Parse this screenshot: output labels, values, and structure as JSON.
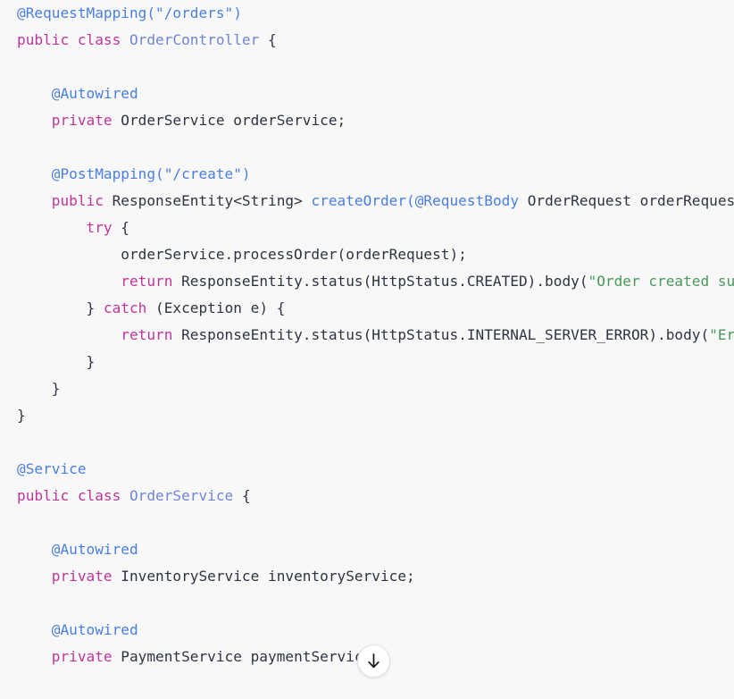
{
  "editor": {
    "background_color": "#f8f8f8",
    "font_size_px": 16,
    "line_height_px": 30,
    "language": "java",
    "syntax_colors": {
      "annotation": "#4a7fe0",
      "keyword": "#c0359b",
      "type_name": "#6f86d6",
      "function_name": "#4a7fe0",
      "string": "#49995c",
      "plain": "#2e3440"
    },
    "lines": [
      {
        "indent": 0,
        "tokens": [
          {
            "t": "@RequestMapping(\"/orders\")",
            "c": "ann"
          }
        ]
      },
      {
        "indent": 0,
        "tokens": [
          {
            "t": "public class ",
            "c": "kw"
          },
          {
            "t": "OrderController",
            "c": "type"
          },
          {
            "t": " {",
            "c": "plain"
          }
        ]
      },
      {
        "indent": 0,
        "tokens": []
      },
      {
        "indent": 1,
        "tokens": [
          {
            "t": "@Autowired",
            "c": "ann"
          }
        ]
      },
      {
        "indent": 1,
        "tokens": [
          {
            "t": "private",
            "c": "kw"
          },
          {
            "t": " OrderService orderService;",
            "c": "plain"
          }
        ]
      },
      {
        "indent": 0,
        "tokens": []
      },
      {
        "indent": 1,
        "tokens": [
          {
            "t": "@PostMapping(\"/create\")",
            "c": "ann"
          }
        ]
      },
      {
        "indent": 1,
        "tokens": [
          {
            "t": "public",
            "c": "kw"
          },
          {
            "t": " ResponseEntity<String> ",
            "c": "plain"
          },
          {
            "t": "createOrder(",
            "c": "fn"
          },
          {
            "t": "@RequestBody",
            "c": "ann"
          },
          {
            "t": " OrderRequest orderRequest) {",
            "c": "plain"
          }
        ]
      },
      {
        "indent": 2,
        "tokens": [
          {
            "t": "try",
            "c": "kw"
          },
          {
            "t": " {",
            "c": "plain"
          }
        ]
      },
      {
        "indent": 3,
        "tokens": [
          {
            "t": "orderService.processOrder(orderRequest);",
            "c": "plain"
          }
        ]
      },
      {
        "indent": 3,
        "tokens": [
          {
            "t": "return",
            "c": "kw"
          },
          {
            "t": " ResponseEntity.status(HttpStatus.CREATED).body(",
            "c": "plain"
          },
          {
            "t": "\"Order created successfully\"",
            "c": "str"
          },
          {
            "t": ");",
            "c": "plain"
          }
        ]
      },
      {
        "indent": 2,
        "tokens": [
          {
            "t": "} ",
            "c": "plain"
          },
          {
            "t": "catch",
            "c": "kw"
          },
          {
            "t": " (Exception e) {",
            "c": "plain"
          }
        ]
      },
      {
        "indent": 3,
        "tokens": [
          {
            "t": "return",
            "c": "kw"
          },
          {
            "t": " ResponseEntity.status(HttpStatus.INTERNAL_SERVER_ERROR).body(",
            "c": "plain"
          },
          {
            "t": "\"Error processing order\"",
            "c": "str"
          },
          {
            "t": ");",
            "c": "plain"
          }
        ]
      },
      {
        "indent": 2,
        "tokens": [
          {
            "t": "}",
            "c": "plain"
          }
        ]
      },
      {
        "indent": 1,
        "tokens": [
          {
            "t": "}",
            "c": "plain"
          }
        ]
      },
      {
        "indent": 0,
        "tokens": [
          {
            "t": "}",
            "c": "plain"
          }
        ]
      },
      {
        "indent": 0,
        "tokens": []
      },
      {
        "indent": 0,
        "tokens": [
          {
            "t": "@Service",
            "c": "ann"
          }
        ]
      },
      {
        "indent": 0,
        "tokens": [
          {
            "t": "public class ",
            "c": "kw"
          },
          {
            "t": "OrderService",
            "c": "type"
          },
          {
            "t": " {",
            "c": "plain"
          }
        ]
      },
      {
        "indent": 0,
        "tokens": []
      },
      {
        "indent": 1,
        "tokens": [
          {
            "t": "@Autowired",
            "c": "ann"
          }
        ]
      },
      {
        "indent": 1,
        "tokens": [
          {
            "t": "private",
            "c": "kw"
          },
          {
            "t": " InventoryService inventoryService;",
            "c": "plain"
          }
        ]
      },
      {
        "indent": 0,
        "tokens": []
      },
      {
        "indent": 1,
        "tokens": [
          {
            "t": "@Autowired",
            "c": "ann"
          }
        ]
      },
      {
        "indent": 1,
        "tokens": [
          {
            "t": "private",
            "c": "kw"
          },
          {
            "t": " PaymentService paymentService;",
            "c": "plain"
          }
        ]
      }
    ]
  },
  "scroll_down_button": {
    "icon": "arrow-down-icon",
    "label": "",
    "background_color": "#ffffff",
    "border_color": "#e3e3e5",
    "arrow_color": "#111111"
  }
}
